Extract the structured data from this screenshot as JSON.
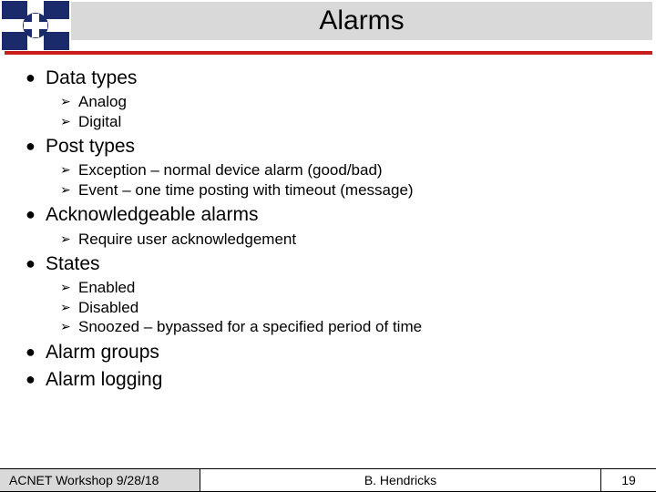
{
  "title": "Alarms",
  "items": [
    {
      "label": "Data types",
      "sub": [
        "Analog",
        "Digital"
      ]
    },
    {
      "label": "Post types",
      "sub": [
        "Exception – normal device alarm (good/bad)",
        "Event – one time posting with timeout (message)"
      ]
    },
    {
      "label": "Acknowledgeable alarms",
      "sub": [
        "Require user acknowledgement"
      ]
    },
    {
      "label": "States",
      "sub": [
        "Enabled",
        "Disabled",
        "Snoozed – bypassed for a specified period of time"
      ]
    },
    {
      "label": "Alarm groups",
      "sub": []
    },
    {
      "label": "Alarm logging",
      "sub": []
    }
  ],
  "footer": {
    "left": "ACNET Workshop 9/28/18",
    "mid": "B. Hendricks",
    "right": "19"
  }
}
